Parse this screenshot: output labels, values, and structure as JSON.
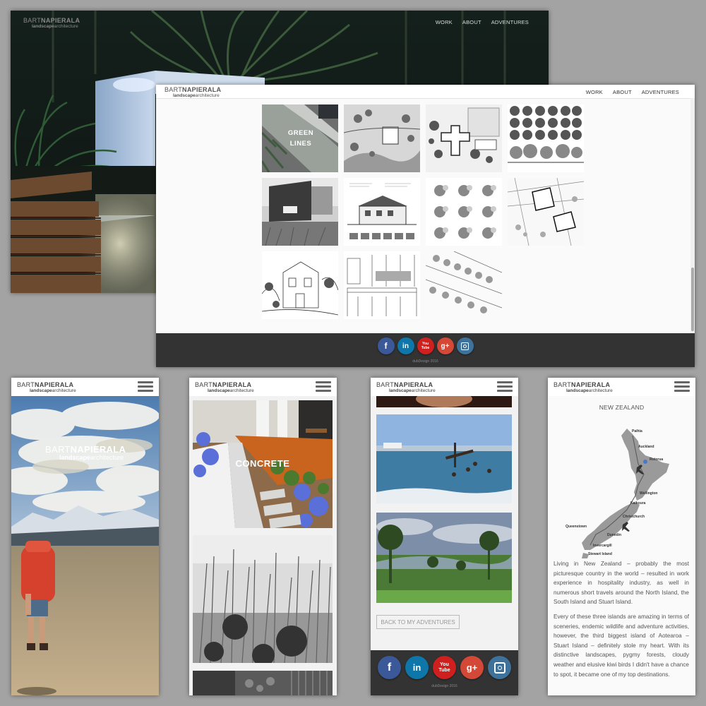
{
  "logo": {
    "first": "BART",
    "last": "NAPIERALA",
    "sub1": "landscape",
    "sub2": "architecture"
  },
  "nav": {
    "work": "WORK",
    "about": "ABOUT",
    "adventures": "ADVENTURES"
  },
  "portfolio": {
    "green_lines": "GREEN LINES"
  },
  "footer": {
    "copyright": "dubDesign 2016"
  },
  "social": {
    "facebook": "f",
    "linkedin": "in",
    "youtube": "You\nTube",
    "googleplus": "g+"
  },
  "mobile_concrete": {
    "label": "CONCRETE"
  },
  "mobile_adventures": {
    "back_button": "BACK TO MY ADVENTURES"
  },
  "new_zealand": {
    "title": "NEW ZEALAND",
    "places": [
      "Paihia",
      "Auckland",
      "Rotorua",
      "Wellington",
      "Kaikoura",
      "Christchurch",
      "Queenstown",
      "Dunedin",
      "Invercargill",
      "Stewart Island"
    ],
    "para1": "Living in New Zealand – probably the most picturesque country in the world – resulted in work experience in hospitality industry, as well in numerous short travels around the North Island, the South Island and Stuart Island.",
    "para2": "Every of these three islands are amazing in terms of sceneries, endemic wildlife and adventure activities, however, the third biggest island of Aotearoa – Stuart Island – definitely stole my heart. With its distinctive landscapes, pygmy forests, cloudy weather and elusive kiwi birds I didn't have a chance to spot, it became one of my top destinations."
  },
  "colors": {
    "dark_bar": "#333333",
    "facebook": "#3b5998",
    "linkedin": "#0e76a8",
    "youtube": "#cd201f",
    "googleplus": "#d34836",
    "instagram": "#3f729b"
  }
}
